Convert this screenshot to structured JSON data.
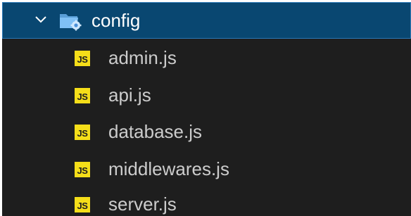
{
  "folder": {
    "name": "config",
    "expanded": true,
    "icon": "folder-config-icon",
    "chevron_icon": "chevron-down-icon"
  },
  "files": [
    {
      "name": "admin.js",
      "icon": "js-file-icon",
      "icon_text": "JS"
    },
    {
      "name": "api.js",
      "icon": "js-file-icon",
      "icon_text": "JS"
    },
    {
      "name": "database.js",
      "icon": "js-file-icon",
      "icon_text": "JS"
    },
    {
      "name": "middlewares.js",
      "icon": "js-file-icon",
      "icon_text": "JS"
    },
    {
      "name": "server.js",
      "icon": "js-file-icon",
      "icon_text": "JS"
    }
  ],
  "colors": {
    "background": "#1e1e1e",
    "selection": "#094771",
    "selection_border": "#2b79b8",
    "text": "#cccccc",
    "js_badge": "#f5de19",
    "folder_icon": "#75beff"
  }
}
